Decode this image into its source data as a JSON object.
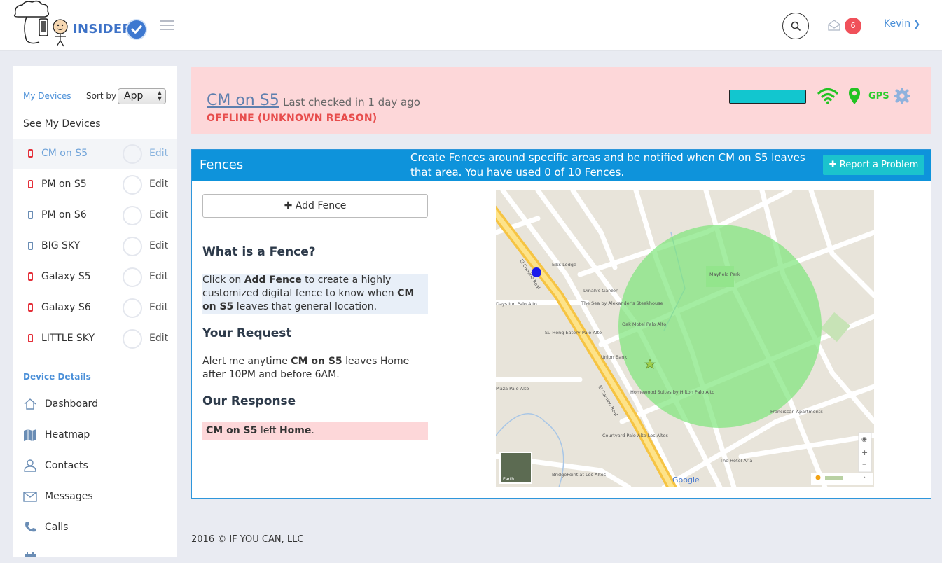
{
  "header": {
    "brand": "INSIDER",
    "notification_count": "6",
    "user_name": "Kevin"
  },
  "sidebar": {
    "my_devices_label": "My Devices",
    "sort_by_label": "Sort by",
    "sort_value": "App",
    "see_all_label": "See My Devices",
    "devices": [
      {
        "name": "CM on S5",
        "edit": "Edit",
        "icon_color": "red"
      },
      {
        "name": "PM on S5",
        "edit": "Edit",
        "icon_color": "red"
      },
      {
        "name": "PM on S6",
        "edit": "Edit",
        "icon_color": "blue"
      },
      {
        "name": "BIG SKY",
        "edit": "Edit",
        "icon_color": "blue"
      },
      {
        "name": "Galaxy S5",
        "edit": "Edit",
        "icon_color": "red"
      },
      {
        "name": "Galaxy S6",
        "edit": "Edit",
        "icon_color": "red"
      },
      {
        "name": "LITTLE SKY",
        "edit": "Edit",
        "icon_color": "red"
      }
    ],
    "device_details_label": "Device Details",
    "nav": [
      {
        "label": "Dashboard",
        "icon": "home-icon"
      },
      {
        "label": "Heatmap",
        "icon": "map-icon"
      },
      {
        "label": "Contacts",
        "icon": "user-icon"
      },
      {
        "label": "Messages",
        "icon": "envelope-icon"
      },
      {
        "label": "Calls",
        "icon": "phone-icon"
      }
    ]
  },
  "status": {
    "device_name": "CM on S5",
    "last_checked": "Last checked in 1 day ago",
    "state": "OFFLINE (UNKNOWN REASON)",
    "gps_label": "GPS",
    "accent_color": "#12c6cf"
  },
  "fences": {
    "title": "Fences",
    "description": "Create Fences around specific areas and be notified when CM on S5 leaves that area. You have used 0 of 10 Fences.",
    "report_button": "Report a Problem",
    "add_button": "Add Fence",
    "what_heading": "What is a Fence?",
    "what_text": {
      "t1": "Click on ",
      "b1": "Add Fence",
      "t2": " to create a highly customized digital fence to know when ",
      "b2": "CM on S5",
      "t3": " leaves that general location."
    },
    "request_heading": "Your Request",
    "request_text": {
      "t1": "Alert me anytime ",
      "b1": "CM on S5",
      "t2": " leaves Home after 10PM and before 6AM."
    },
    "response_heading": "Our Response",
    "response_text": {
      "b1": "CM on S5",
      "t1": " left ",
      "b2": "Home",
      "t2": "."
    },
    "map": {
      "labels": [
        "El Camino Real",
        "Elks Lodge",
        "Dinah's Garden",
        "The Sea by Alexander's Steakhouse",
        "Su Hong Eatery-Palo Alto",
        "Oak Motel Palo Alto",
        "Union Bank",
        "Homewood Suites by Hilton Palo Alto",
        "Mayfield Park",
        "Franciscan Apartments",
        "The Hotel Aria",
        "Courtyard Palo Alto Los Altos",
        "BridgePoint at Los Altos",
        "Plaza Palo Alto",
        "Days Inn Palo Alto",
        "Earth",
        "Google"
      ]
    }
  },
  "footer": {
    "text": "2016 © IF YOU CAN, LLC"
  }
}
